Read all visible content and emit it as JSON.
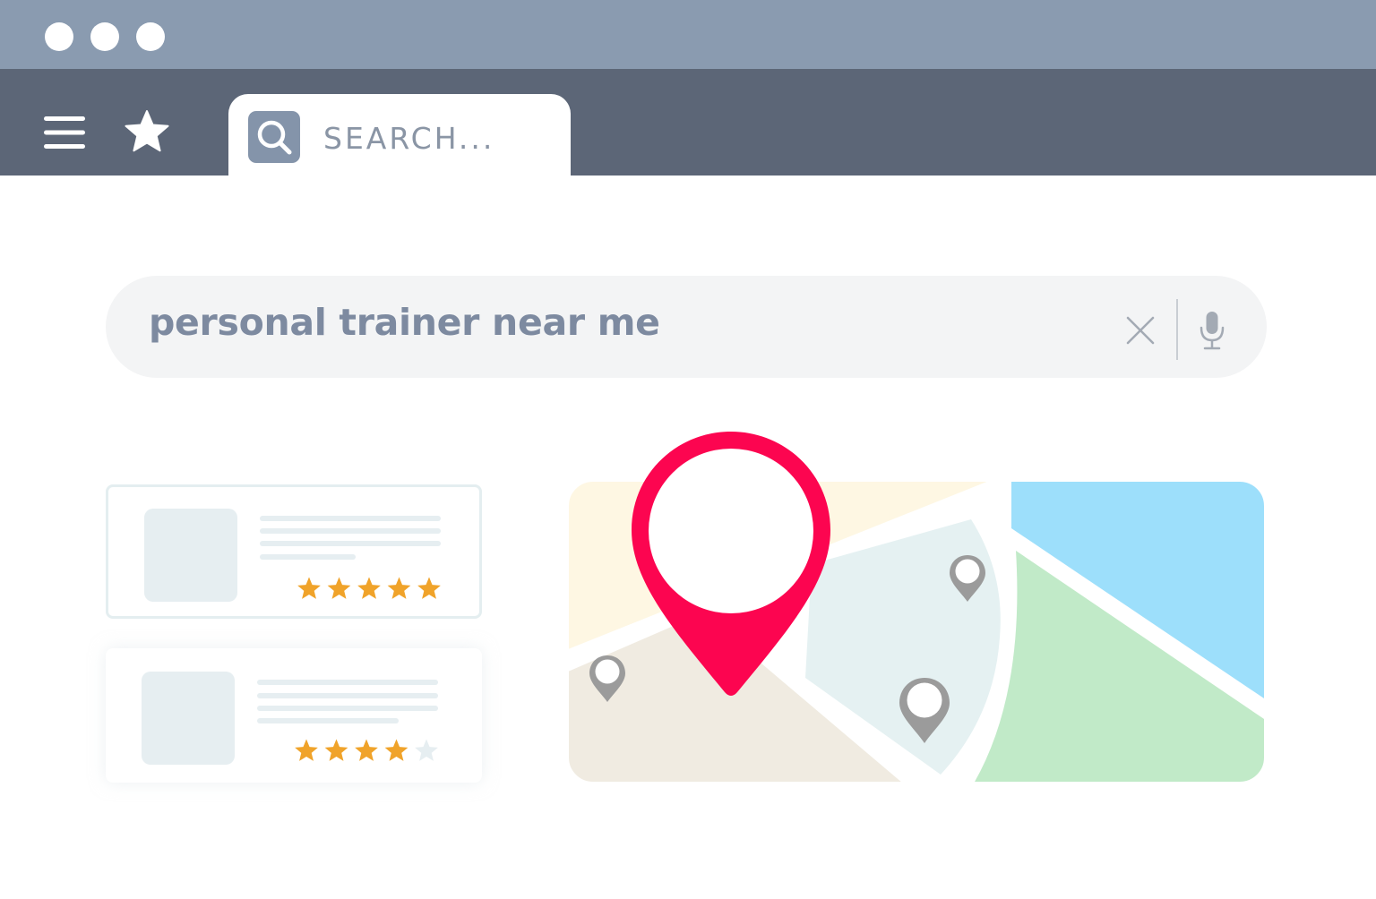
{
  "browser": {
    "window_controls": [
      "close",
      "minimize",
      "maximize"
    ],
    "tab": {
      "label": "SEARCH...",
      "icon": "search-icon"
    },
    "toolbar_icons": [
      "menu-icon",
      "star-icon"
    ]
  },
  "search": {
    "query": "personal trainer near me",
    "clear_icon": "close-icon",
    "voice_icon": "microphone-icon"
  },
  "results": [
    {
      "rating": 5,
      "max_rating": 5
    },
    {
      "rating": 4,
      "max_rating": 5
    }
  ],
  "colors": {
    "titlebar": "#8a9bb0",
    "toolbar": "#5c6677",
    "pin": "#fc0550",
    "star": "#f0a32a",
    "map_water": "#9ddffb",
    "map_park": "#c1eac8"
  }
}
